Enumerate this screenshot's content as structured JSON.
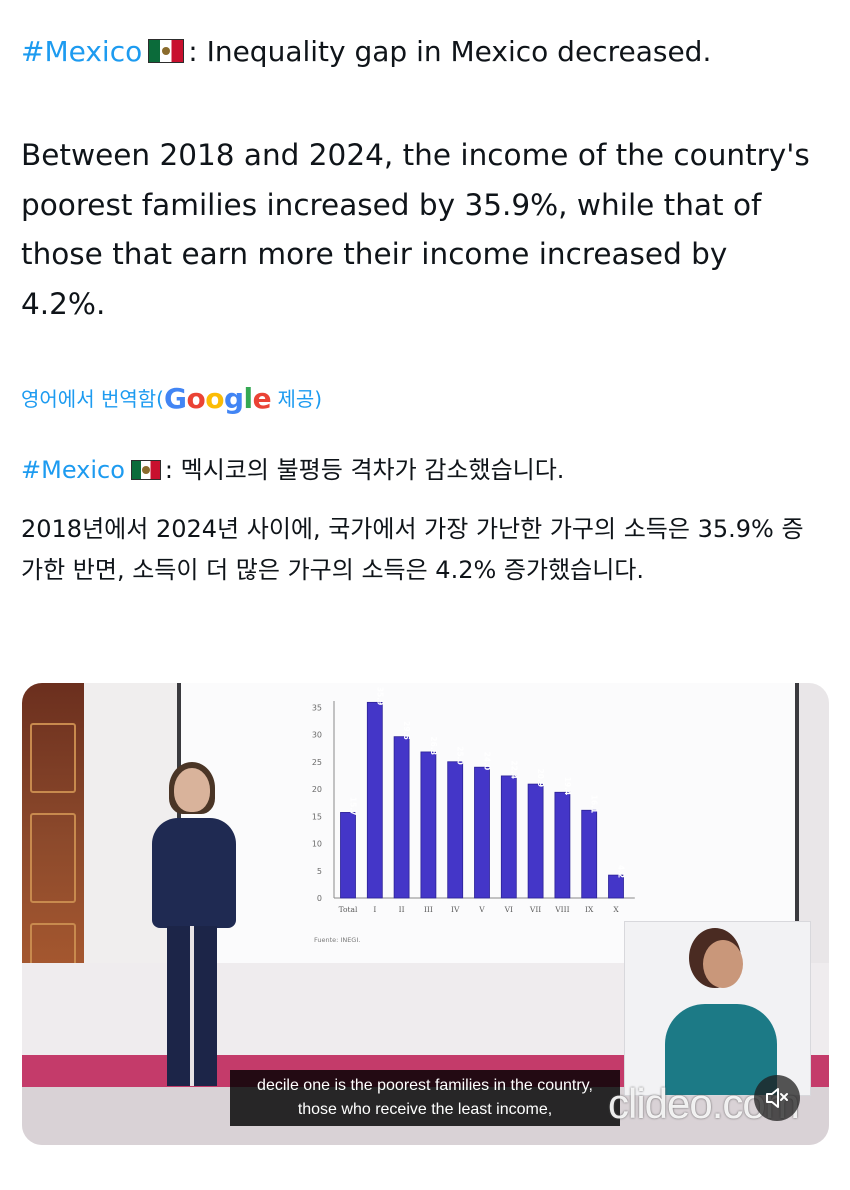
{
  "tweet": {
    "hashtag": "#Mexico",
    "headline": ": Inequality gap in Mexico decreased.",
    "body": "Between 2018 and 2024, the income of the country's poorest families increased by 35.9%, while that of those that earn more their income increased by 4.2%."
  },
  "translation": {
    "prefix": "영어에서 번역함(",
    "provider_letters": [
      "G",
      "o",
      "o",
      "g",
      "l",
      "e"
    ],
    "suffix": " 제공)",
    "hashtag": "#Mexico",
    "headline": ": 멕시코의 불평등 격차가 감소했습니다.",
    "body": "2018년에서 2024년 사이에, 국가에서 가장 가난한 가구의 소득은 35.9% 증가한 반면, 소득이 더 많은 가구의 소득은 4.2% 증가했습니다."
  },
  "video": {
    "caption_line1": "decile one is the poorest families in the country,",
    "caption_line2": "those who receive the least income,",
    "watermark": "clideo.com",
    "mute_icon": "speaker-muted-icon"
  },
  "colors": {
    "link": "#1d9bf0",
    "bar": "#4436c8",
    "google_blue": "#4285f4",
    "google_red": "#ea4335",
    "google_yellow": "#fbbc05",
    "google_green": "#34a853"
  },
  "chart_data": {
    "type": "bar",
    "categories": [
      "Total",
      "I",
      "II",
      "III",
      "IV",
      "V",
      "VI",
      "VII",
      "VIII",
      "IX",
      "X"
    ],
    "values": [
      15.7,
      35.9,
      29.6,
      26.8,
      25.0,
      24.0,
      22.4,
      20.9,
      19.4,
      16.1,
      4.2
    ],
    "value_labels": [
      "15.7",
      "35.9",
      "29.6",
      "26.8",
      "25.0",
      "24.0",
      "22.4",
      "20.9",
      "19.4",
      "16.1",
      "4.2"
    ],
    "yticks": [
      "0",
      "5",
      "10",
      "15",
      "20",
      "25",
      "30",
      "35"
    ],
    "ylim": [
      0,
      37
    ],
    "source": "Fuente: INEGI.",
    "grid": false
  }
}
